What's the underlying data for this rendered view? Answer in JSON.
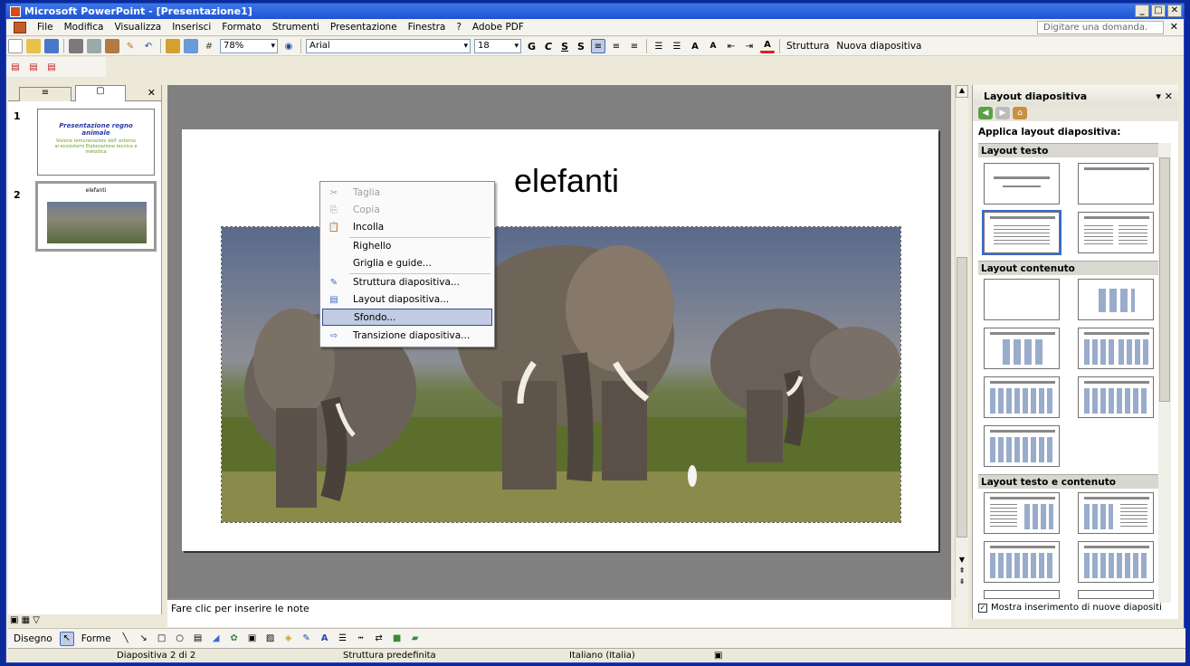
{
  "window": {
    "title": "Microsoft PowerPoint - [Presentazione1]"
  },
  "menu": [
    "File",
    "Modifica",
    "Visualizza",
    "Inserisci",
    "Formato",
    "Strumenti",
    "Presentazione",
    "Finestra",
    "?",
    "Adobe PDF"
  ],
  "ask_placeholder": "Digitare una domanda.",
  "toolbar": {
    "zoom": "78%",
    "font": "Arial",
    "size": "18",
    "bold": "G",
    "italic": "C",
    "underline": "S",
    "shadow": "S",
    "design_label": "Struttura",
    "new_slide_label": "Nuova diapositiva"
  },
  "slides": [
    {
      "number": "1",
      "title": "Presentazione regno animale",
      "body": "Visione remunerazioni dell' esterno ai ecosistemi Elaborazione tecnica e metodica"
    },
    {
      "number": "2",
      "title": "elefanti"
    }
  ],
  "slide": {
    "title": "elefanti"
  },
  "notes_placeholder": "Fare clic per inserire le note",
  "context_menu": {
    "items": [
      {
        "label": "Taglia",
        "icon": "scissors-icon",
        "disabled": true
      },
      {
        "label": "Copia",
        "icon": "copy-icon",
        "disabled": true
      },
      {
        "label": "Incolla",
        "icon": "paste-icon",
        "disabled": false
      },
      {
        "label": "Righello",
        "icon": "",
        "disabled": false
      },
      {
        "label": "Griglia e guide...",
        "icon": "",
        "disabled": false
      },
      {
        "label": "Struttura diapositiva...",
        "icon": "design-icon",
        "disabled": false
      },
      {
        "label": "Layout diapositiva...",
        "icon": "layout-icon",
        "disabled": false
      },
      {
        "label": "Sfondo...",
        "icon": "",
        "disabled": false,
        "highlighted": true
      },
      {
        "label": "Transizione diapositiva...",
        "icon": "transition-icon",
        "disabled": false
      }
    ]
  },
  "task_pane": {
    "title": "Layout diapositiva",
    "apply_label": "Applica layout diapositiva:",
    "sections": [
      "Layout testo",
      "Layout contenuto",
      "Layout testo e contenuto"
    ],
    "show_checkbox": "Mostra inserimento di nuove diapositi",
    "checked": true
  },
  "drawbar": {
    "draw": "Disegno",
    "shapes": "Forme"
  },
  "status": {
    "slide": "Diapositiva 2 di 2",
    "design": "Struttura predefinita",
    "language": "Italiano (Italia)"
  },
  "colors": {
    "titlebar": "#1d52d2",
    "highlight": "#c1cce3"
  }
}
